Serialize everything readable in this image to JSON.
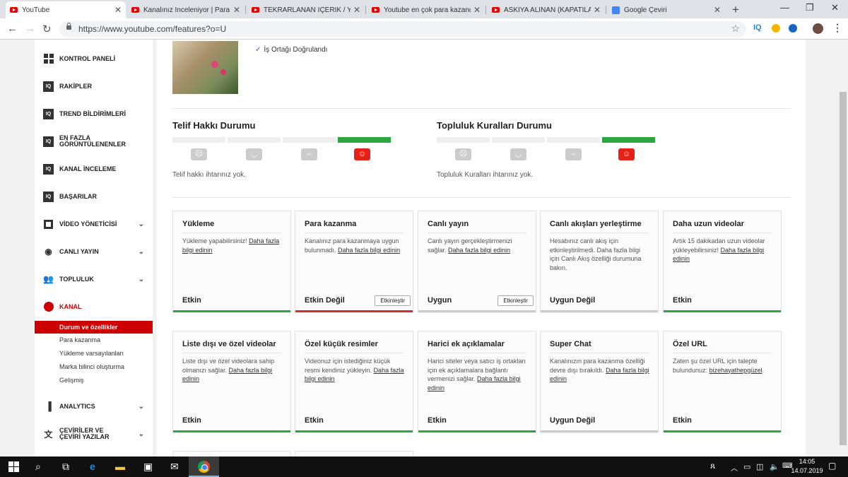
{
  "browser": {
    "tabs": [
      {
        "label": "YouTube",
        "icon": "youtube-icon",
        "active": true
      },
      {
        "label": "Kanalınız İnceleniyor | Para Ka",
        "icon": "youtube-icon"
      },
      {
        "label": "TEKRARLANAN İÇERİK / YENİ",
        "icon": "youtube-icon"
      },
      {
        "label": "Youtube en çok para kazandı",
        "icon": "youtube-icon"
      },
      {
        "label": "ASKIYA ALINAN (KAPATILAN)",
        "icon": "youtube-icon"
      },
      {
        "label": "Google Çeviri",
        "icon": "google-translate-icon"
      }
    ],
    "url": "https://www.youtube.com/features?o=U",
    "extension_label": "IQ"
  },
  "sidebar": {
    "items": [
      {
        "label": "KONTROL PANELİ",
        "icon": "dashboard-icon"
      },
      {
        "label": "RAKİPLER",
        "icon": "vidiq-icon"
      },
      {
        "label": "TREND BİLDİRİMLERİ",
        "icon": "vidiq-icon"
      },
      {
        "label": "EN FAZLA GÖRÜNTÜLENENLER",
        "icon": "vidiq-icon"
      },
      {
        "label": "KANAL İNCELEME",
        "icon": "vidiq-icon"
      },
      {
        "label": "BAŞARILAR",
        "icon": "vidiq-icon"
      },
      {
        "label": "VİDEO YÖNETİCİSİ",
        "icon": "video-manager-icon"
      },
      {
        "label": "CANLI YAYIN",
        "icon": "live-icon"
      },
      {
        "label": "TOPLULUK",
        "icon": "community-icon"
      },
      {
        "label": "KANAL",
        "icon": "channel-icon"
      }
    ],
    "subitems": [
      {
        "label": "Durum ve özellikler",
        "active": true
      },
      {
        "label": "Para kazanma"
      },
      {
        "label": "Yükleme varsayılanları"
      },
      {
        "label": "Marka bilinci oluşturma"
      },
      {
        "label": "Gelişmiş"
      }
    ],
    "bottom_items": [
      {
        "label": "ANALYTICS",
        "icon": "analytics-icon"
      },
      {
        "label": "ÇEVİRİLER VE ÇEVİRİ YAZILAR",
        "icon": "translate-icon"
      }
    ]
  },
  "main": {
    "verified_label": "İş Ortağı Doğrulandı",
    "copyright": {
      "title": "Telif Hakkı Durumu",
      "note": "Telif hakkı ihtarınız yok."
    },
    "community": {
      "title": "Topluluk Kuralları Durumu",
      "note": "Topluluk Kuralları ihtarınız yok."
    },
    "cards_row1": [
      {
        "title": "Yükleme",
        "desc": "Yükleme yapabilirsiniz!",
        "link": "Daha fazla bilgi edinin",
        "status": "Etkin",
        "state": "ok"
      },
      {
        "title": "Para kazanma",
        "desc": "Kanalınız para kazanmaya uygun bulunmadı.",
        "link": "Daha fazla bilgi edinin",
        "status": "Etkin Değil",
        "state": "bad",
        "button": "Etkinleştir"
      },
      {
        "title": "Canlı yayın",
        "desc": "Canlı yayın gerçekleştirmenizi sağlar.",
        "link": "Daha fazla bilgi edinin",
        "status": "Uygun",
        "state": "neutral",
        "button": "Etkinleştir"
      },
      {
        "title": "Canlı akışları yerleştirme",
        "desc": "Hesabınız canlı akış için etkinleştirilmedi. Daha fazla bilgi için Canlı Akış özelliği durumuna bakın.",
        "link": "",
        "status": "Uygun Değil",
        "state": "neutral"
      },
      {
        "title": "Daha uzun videolar",
        "desc": "Artık 15 dakikadan uzun videolar yükleyebilirsiniz!",
        "link": "Daha fazla bilgi edinin",
        "status": "Etkin",
        "state": "ok"
      }
    ],
    "cards_row2": [
      {
        "title": "Liste dışı ve özel videolar",
        "desc": "Liste dışı ve özel videolara sahip olmanızı sağlar.",
        "link": "Daha fazla bilgi edinin",
        "status": "Etkin",
        "state": "ok"
      },
      {
        "title": "Özel küçük resimler",
        "desc": "Videonuz için istediğiniz küçük resmi kendiniz yükleyin.",
        "link": "Daha fazla bilgi edinin",
        "status": "Etkin",
        "state": "ok"
      },
      {
        "title": "Harici ek açıklamalar",
        "desc": "Harici siteler veya satıcı iş ortakları için ek açıklamalara bağlantı vermenizi sağlar.",
        "link": "Daha fazla bilgi edinin",
        "status": "Etkin",
        "state": "ok"
      },
      {
        "title": "Super Chat",
        "desc": "Kanalınızın para kazanma özelliği devre dışı bırakıldı.",
        "link": "Daha fazla bilgi edinin",
        "status": "Uygun Değil",
        "state": "neutral"
      },
      {
        "title": "Özel URL",
        "desc": "Zaten şu özel URL için talepte bulundunuz:",
        "link": "bizehayathepgüzel",
        "status": "Etkin",
        "state": "ok"
      }
    ]
  },
  "taskbar": {
    "time": "14:05",
    "date": "14.07.2019"
  },
  "colors": {
    "brand_red": "#cc0000",
    "ok_green": "#2ba640",
    "bad_red": "#d32f2f"
  }
}
